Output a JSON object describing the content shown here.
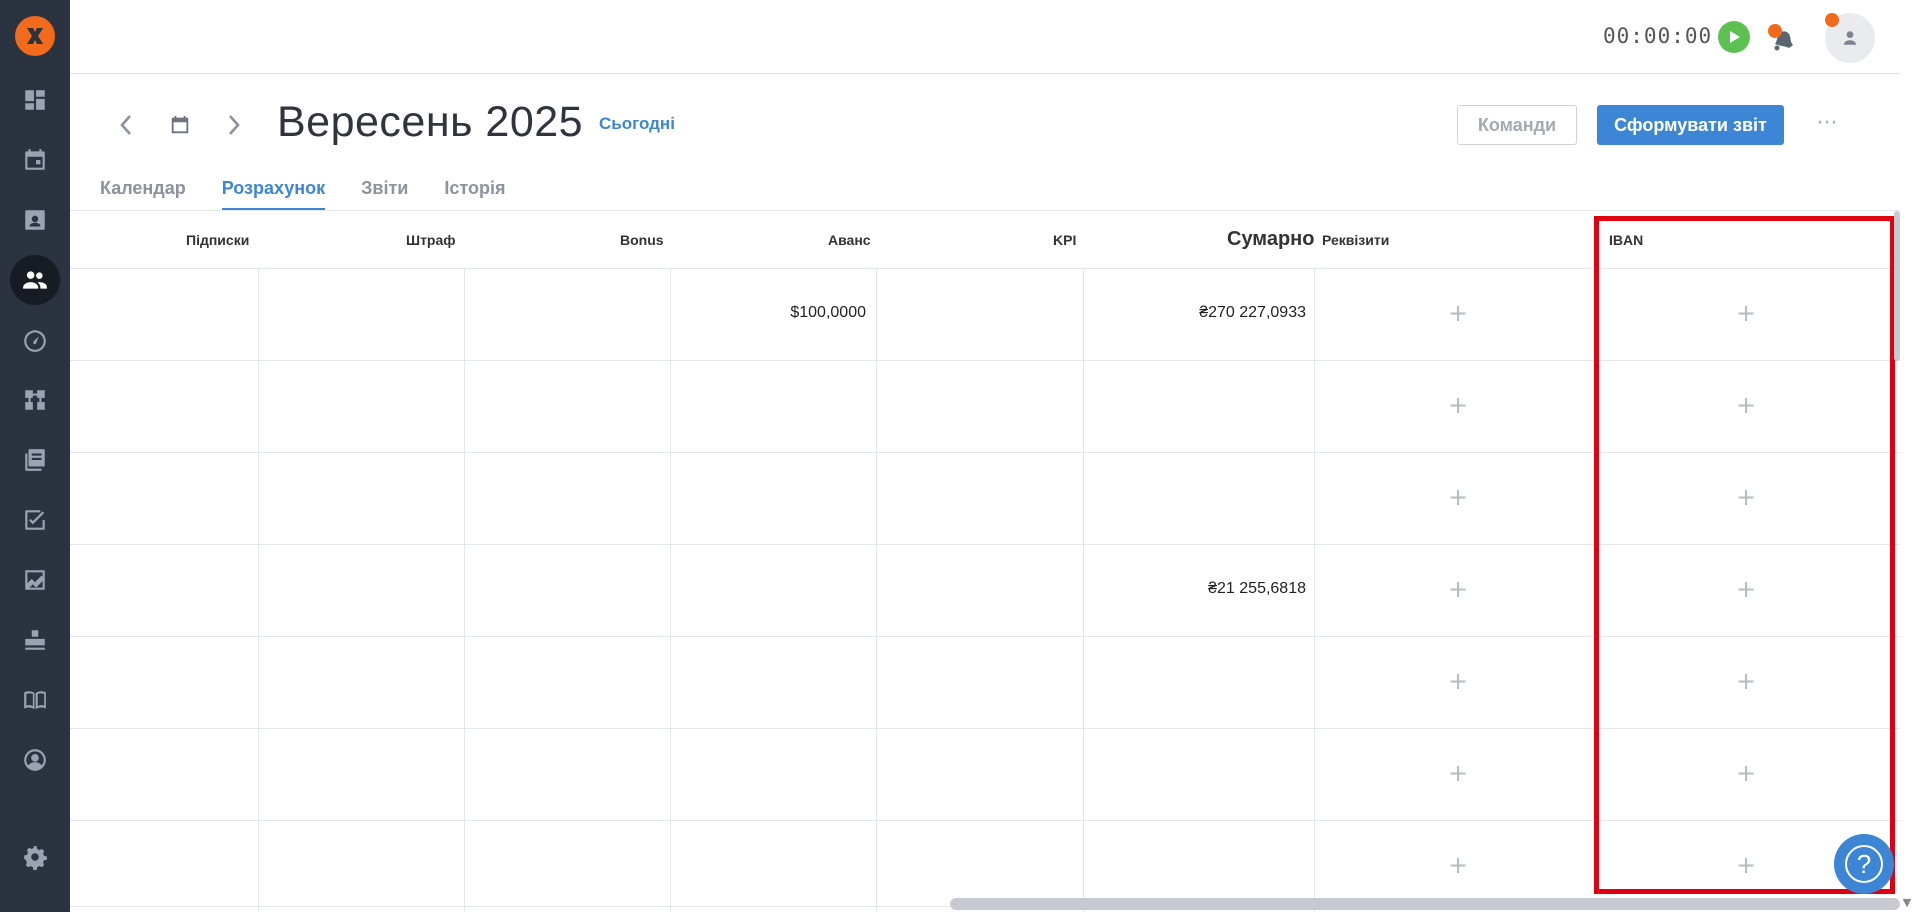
{
  "sidebar": {
    "items": [
      {
        "name": "dashboard-icon"
      },
      {
        "name": "calendar-icon"
      },
      {
        "name": "contacts-icon"
      },
      {
        "name": "team-icon",
        "active": true
      },
      {
        "name": "speedometer-icon"
      },
      {
        "name": "workflow-icon"
      },
      {
        "name": "library-icon"
      },
      {
        "name": "tasks-icon"
      },
      {
        "name": "chart-icon"
      },
      {
        "name": "boxes-icon"
      },
      {
        "name": "book-icon"
      },
      {
        "name": "profile-icon"
      }
    ],
    "settings_icon": "gear-icon"
  },
  "topbar": {
    "timer": "00:00:00"
  },
  "header": {
    "title": "Вересень 2025",
    "today_label": "Сьогодні",
    "teams_button": "Команди",
    "report_button": "Сформувати звіт",
    "more": "···"
  },
  "tabs": [
    {
      "label": "Календар"
    },
    {
      "label": "Розрахунок",
      "active": true
    },
    {
      "label": "Звіти"
    },
    {
      "label": "Історія"
    }
  ],
  "table": {
    "columns": [
      "Підписки",
      "Штраф",
      "Bonus",
      "Аванс",
      "KPI",
      "Сумарно",
      "Реквізити",
      "IBAN"
    ],
    "rows": [
      {
        "advance": "$100,0000",
        "total": "₴270 227,0933"
      },
      {
        "advance": "",
        "total": ""
      },
      {
        "advance": "",
        "total": ""
      },
      {
        "advance": "",
        "total": "₴21 255,6818"
      },
      {
        "advance": "",
        "total": ""
      },
      {
        "advance": "",
        "total": ""
      },
      {
        "advance": "",
        "total": ""
      }
    ]
  },
  "help": "?"
}
